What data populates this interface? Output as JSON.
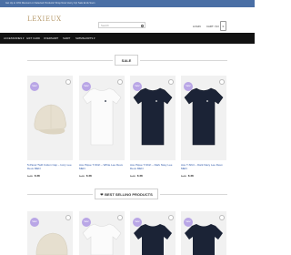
{
  "topbar": {
    "text": "Get Up to 10% Discount on Selected Products! Shop Now! Hurry Up! Sale Ends Soon"
  },
  "header": {
    "logo": "LEXIEUX",
    "search_placeholder": "Search",
    "login_label": "LOGIN",
    "cart_label": "CART / $ 0",
    "cart_count": "0"
  },
  "nav": {
    "items": [
      {
        "label": "ACCESSORIES ▾"
      },
      {
        "label": "GIFT CARD"
      },
      {
        "label": "OVERSHIRT"
      },
      {
        "label": "SHIRT"
      },
      {
        "label": "SWIMSHORTS ▾"
      }
    ]
  },
  "sections": {
    "sale_title": "SALE",
    "best_title": "BEST SELLING PRODUCTS"
  },
  "sale_products": [
    {
      "badge": "Sale!",
      "title": "5-Panel Twill Cotton Cap – Ivory Lee Deux MEN",
      "old_price": "$ 45",
      "new_price": "$ 38",
      "color": "#e8e2d4",
      "kind": "cap"
    },
    {
      "badge": "Sale!",
      "title": "Ace Pique T-Shirt – White Lee Deux MEN",
      "old_price": "$ 45",
      "new_price": "$ 38",
      "color": "#fafafa",
      "kind": "tee"
    },
    {
      "badge": "Sale!",
      "title": "Ace Pique T-Shirt – Dark Navy Lee Deux MEN",
      "old_price": "$ 45",
      "new_price": "$ 38",
      "color": "#1b2336",
      "kind": "tee"
    },
    {
      "badge": "Sale!",
      "title": "Ace T-Shirt – Dark Navy Lee Deux MEN",
      "old_price": "$ 45",
      "new_price": "$ 38",
      "color": "#1b2336",
      "kind": "tee"
    }
  ],
  "best_products": [
    {
      "badge": "Sale!",
      "color": "#e8e2d4",
      "kind": "cap"
    },
    {
      "badge": "Sale!",
      "color": "#fafafa",
      "kind": "tee"
    },
    {
      "badge": "Sale!",
      "color": "#1b2336",
      "kind": "tee"
    },
    {
      "badge": "Sale!",
      "color": "#1b2336",
      "kind": "tee"
    }
  ]
}
